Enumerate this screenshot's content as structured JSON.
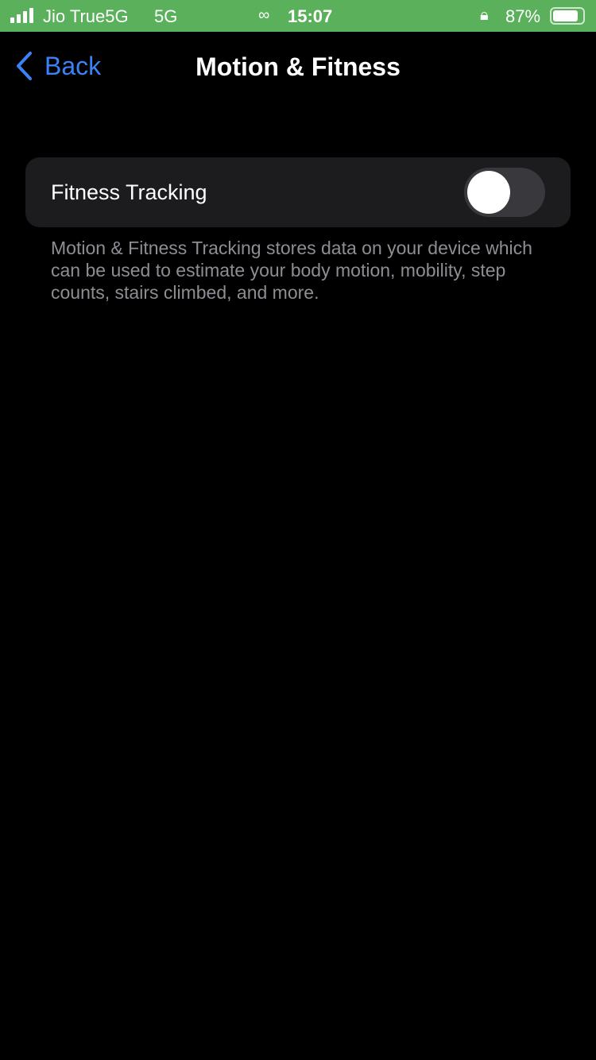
{
  "status_bar": {
    "carrier": "Jio True5G",
    "network": "5G",
    "time": "15:07",
    "battery": "87%",
    "battery_level": 0.87,
    "icons": [
      "signal-icon",
      "link-icon",
      "rotation-lock-icon",
      "battery-icon"
    ],
    "background": "#5bb05b"
  },
  "nav": {
    "back_label": "Back",
    "title": "Motion & Fitness",
    "accent": "#3b82f6"
  },
  "settings": {
    "fitness_tracking": {
      "label": "Fitness Tracking",
      "enabled": false
    },
    "footer": "Motion & Fitness Tracking stores data on your device which can be used to estimate your body motion, mobility, step counts, stairs climbed, and more."
  }
}
